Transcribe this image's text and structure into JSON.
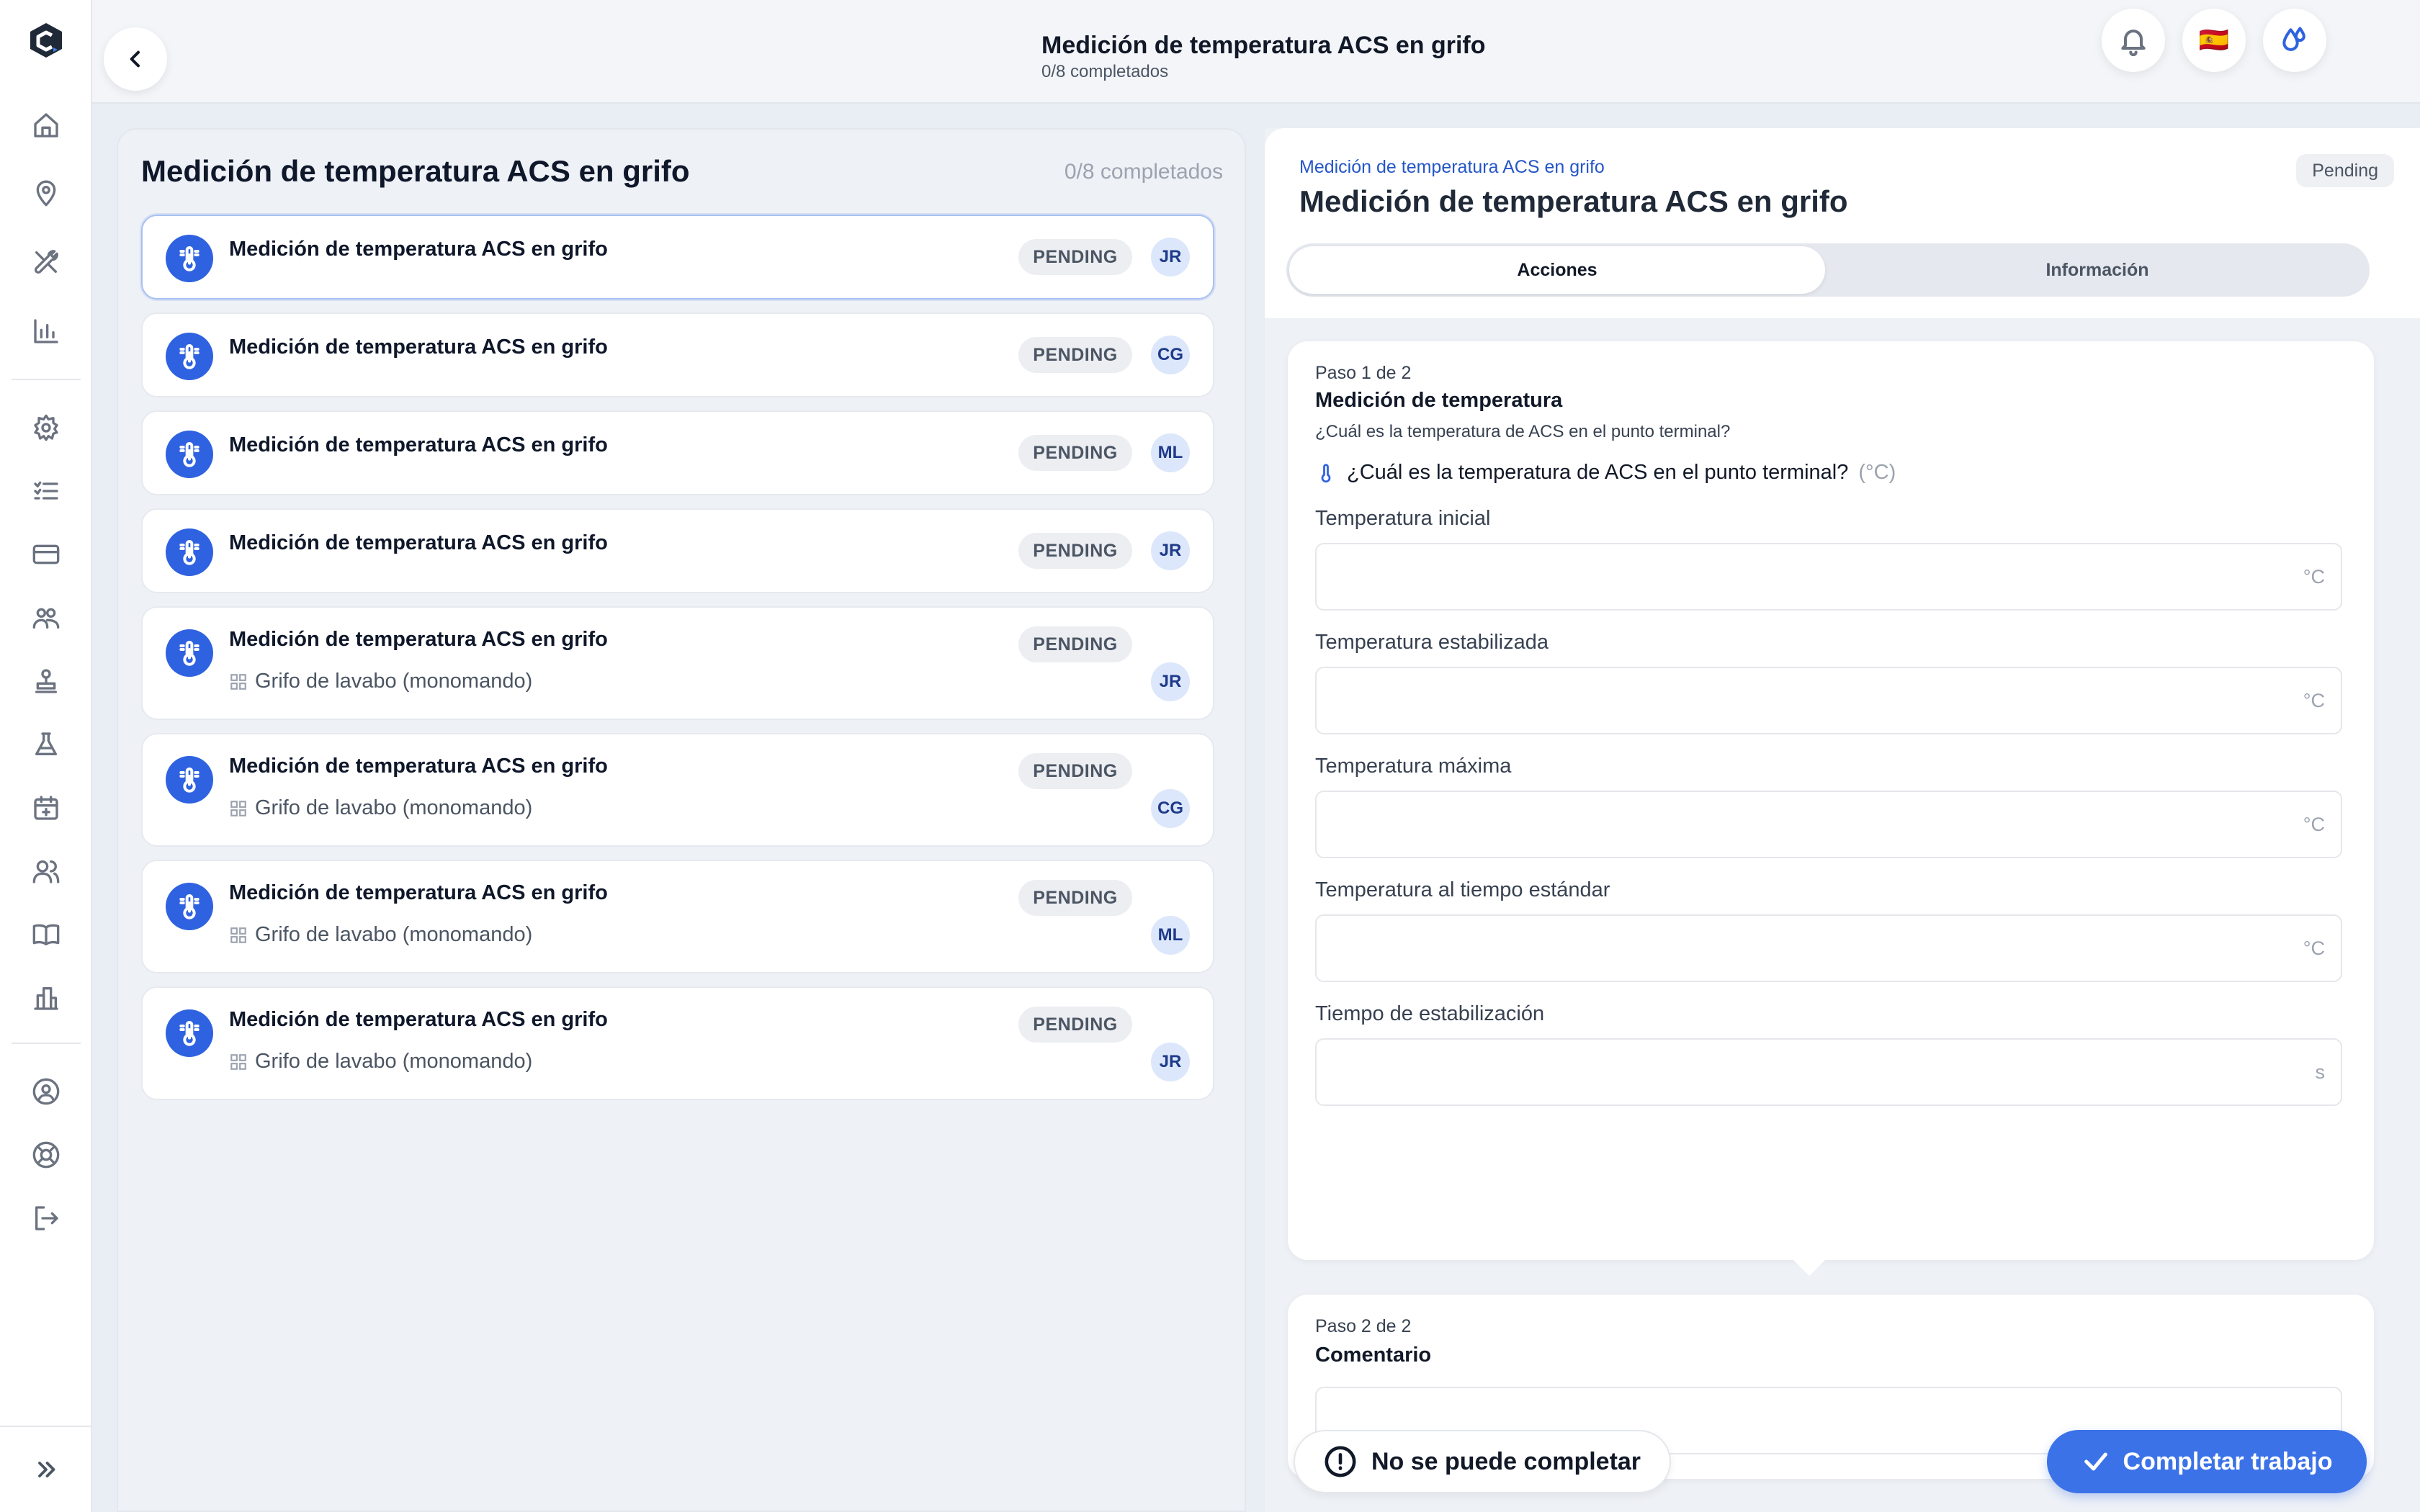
{
  "topbar": {
    "title": "Medición de temperatura ACS en grifo",
    "subtitle": "0/8 completados",
    "language_flag": "🇪🇸"
  },
  "list_panel": {
    "title": "Medición de temperatura ACS en grifo",
    "count": "0/8 completados",
    "tasks": [
      {
        "title": "Medición de temperatura ACS en grifo",
        "status": "PENDING",
        "assignee": "JR",
        "subtitle": ""
      },
      {
        "title": "Medición de temperatura ACS en grifo",
        "status": "PENDING",
        "assignee": "CG",
        "subtitle": ""
      },
      {
        "title": "Medición de temperatura ACS en grifo",
        "status": "PENDING",
        "assignee": "ML",
        "subtitle": ""
      },
      {
        "title": "Medición de temperatura ACS en grifo",
        "status": "PENDING",
        "assignee": "JR",
        "subtitle": ""
      },
      {
        "title": "Medición de temperatura ACS en grifo",
        "status": "PENDING",
        "assignee": "JR",
        "subtitle": "Grifo de lavabo (monomando)"
      },
      {
        "title": "Medición de temperatura ACS en grifo",
        "status": "PENDING",
        "assignee": "CG",
        "subtitle": "Grifo de lavabo (monomando)"
      },
      {
        "title": "Medición de temperatura ACS en grifo",
        "status": "PENDING",
        "assignee": "ML",
        "subtitle": "Grifo de lavabo (monomando)"
      },
      {
        "title": "Medición de temperatura ACS en grifo",
        "status": "PENDING",
        "assignee": "JR",
        "subtitle": "Grifo de lavabo (monomando)"
      }
    ]
  },
  "detail": {
    "breadcrumb": "Medición de temperatura ACS en grifo",
    "title": "Medición de temperatura ACS en grifo",
    "status": "Pending",
    "tabs": {
      "actions": "Acciones",
      "info": "Información"
    },
    "step1": {
      "label": "Paso 1 de 2",
      "title": "Medición de temperatura",
      "description": "¿Cuál es la temperatura de ACS en el punto terminal?",
      "question": "¿Cuál es la temperatura de ACS en el punto terminal?",
      "question_unit": "(°C)",
      "fields": [
        {
          "label": "Temperatura inicial",
          "unit": "°C",
          "value": ""
        },
        {
          "label": "Temperatura estabilizada",
          "unit": "°C",
          "value": ""
        },
        {
          "label": "Temperatura máxima",
          "unit": "°C",
          "value": ""
        },
        {
          "label": "Temperatura al tiempo estándar",
          "unit": "°C",
          "value": ""
        },
        {
          "label": "Tiempo de estabilización",
          "unit": "s",
          "value": ""
        }
      ]
    },
    "step2": {
      "label": "Paso 2 de 2",
      "title": "Comentario",
      "value": ""
    }
  },
  "actions": {
    "cannot_complete": "No se puede completar",
    "complete": "Completar trabajo"
  },
  "colors": {
    "accent": "#2f62e0",
    "primary_button": "#3b72e8",
    "breadcrumb": "#2456c8"
  }
}
